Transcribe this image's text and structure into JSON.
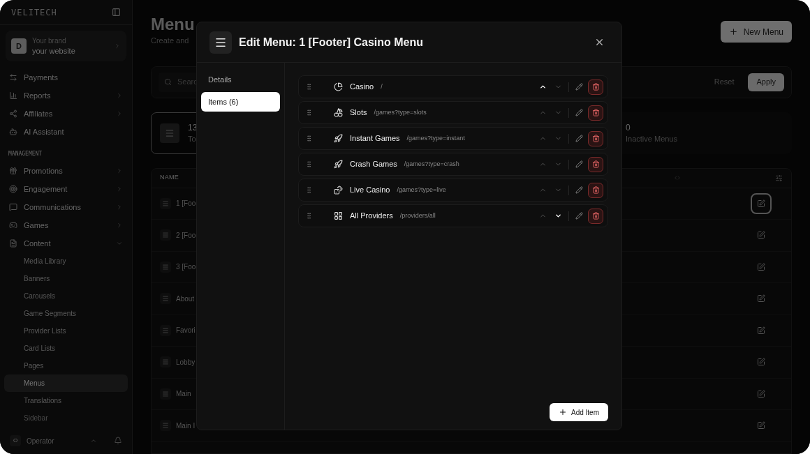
{
  "sidebar": {
    "logo": "VELITECH",
    "brand": {
      "avatar": "D",
      "label": "Your brand",
      "name": "your website"
    },
    "items": [
      {
        "kind": "link",
        "label": "Payments"
      },
      {
        "kind": "group",
        "label": "Reports",
        "expanded": false
      },
      {
        "kind": "group",
        "label": "Affiliates",
        "expanded": false
      },
      {
        "kind": "link",
        "label": "AI Assistant"
      },
      {
        "kind": "heading",
        "label": "MANAGEMENT"
      },
      {
        "kind": "group",
        "label": "Promotions",
        "expanded": false
      },
      {
        "kind": "group",
        "label": "Engagement",
        "expanded": false
      },
      {
        "kind": "group",
        "label": "Communications",
        "expanded": false
      },
      {
        "kind": "group",
        "label": "Games",
        "expanded": false
      },
      {
        "kind": "group",
        "label": "Content",
        "expanded": true
      },
      {
        "kind": "subitem",
        "label": "Media Library",
        "selected": false
      },
      {
        "kind": "subitem",
        "label": "Banners",
        "selected": false
      },
      {
        "kind": "subitem",
        "label": "Carousels",
        "selected": false
      },
      {
        "kind": "subitem",
        "label": "Game Segments",
        "selected": false
      },
      {
        "kind": "subitem",
        "label": "Provider Lists",
        "selected": false
      },
      {
        "kind": "subitem",
        "label": "Card Lists",
        "selected": false
      },
      {
        "kind": "subitem",
        "label": "Pages",
        "selected": false
      },
      {
        "kind": "subitem",
        "label": "Menus",
        "selected": true
      },
      {
        "kind": "subitem",
        "label": "Translations",
        "selected": false
      },
      {
        "kind": "subitem",
        "label": "Sidebar",
        "selected": false
      }
    ],
    "user": {
      "avatar": "O",
      "name": "Operator"
    }
  },
  "page": {
    "title": "Menu",
    "subtitle": "Create and",
    "new_button": "New Menu",
    "search_placeholder": "Searc",
    "reset": "Reset",
    "apply": "Apply",
    "stats": [
      {
        "value": "13",
        "label": "To"
      },
      {
        "value": "0",
        "label": "Inactive Menus"
      }
    ],
    "table": {
      "column_1": "NAME",
      "rows": [
        {
          "name": "1 [Foo",
          "focused": true
        },
        {
          "name": "2 [Foo",
          "focused": false
        },
        {
          "name": "3 [Foo",
          "focused": false
        },
        {
          "name": "About",
          "focused": false
        },
        {
          "name": "Favori",
          "focused": false
        },
        {
          "name": "Lobby",
          "focused": false
        },
        {
          "name": "Main",
          "focused": false
        },
        {
          "name": "Main I",
          "focused": false
        }
      ]
    }
  },
  "dialog": {
    "title": "Edit Menu: 1 [Footer] Casino Menu",
    "tabs": [
      {
        "label": "Details",
        "selected": false
      },
      {
        "label": "Items (6)",
        "selected": true
      }
    ],
    "items": [
      {
        "name": "Casino",
        "path": "/",
        "up_active": true,
        "down_active": false
      },
      {
        "name": "Slots",
        "path": "/games?type=slots",
        "up_active": false,
        "down_active": false
      },
      {
        "name": "Instant Games",
        "path": "/games?type=instant",
        "up_active": false,
        "down_active": false
      },
      {
        "name": "Crash Games",
        "path": "/games?type=crash",
        "up_active": false,
        "down_active": false
      },
      {
        "name": "Live Casino",
        "path": "/games?type=live",
        "up_active": false,
        "down_active": false
      },
      {
        "name": "All Providers",
        "path": "/providers/all",
        "up_active": false,
        "down_active": true
      }
    ],
    "add_button": "Add Item"
  }
}
